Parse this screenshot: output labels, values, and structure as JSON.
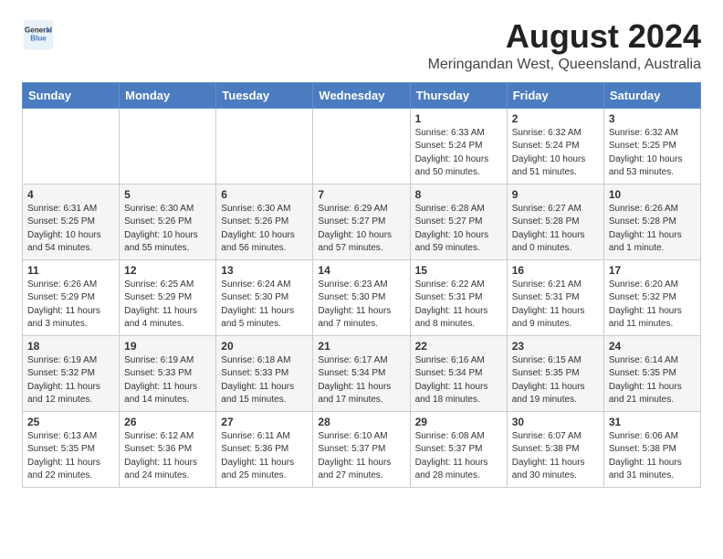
{
  "header": {
    "logo_line1": "General",
    "logo_line2": "Blue",
    "title": "August 2024",
    "subtitle": "Meringandan West, Queensland, Australia"
  },
  "weekdays": [
    "Sunday",
    "Monday",
    "Tuesday",
    "Wednesday",
    "Thursday",
    "Friday",
    "Saturday"
  ],
  "weeks": [
    [
      {
        "day": "",
        "sunrise": "",
        "sunset": "",
        "daylight": ""
      },
      {
        "day": "",
        "sunrise": "",
        "sunset": "",
        "daylight": ""
      },
      {
        "day": "",
        "sunrise": "",
        "sunset": "",
        "daylight": ""
      },
      {
        "day": "",
        "sunrise": "",
        "sunset": "",
        "daylight": ""
      },
      {
        "day": "1",
        "sunrise": "Sunrise: 6:33 AM",
        "sunset": "Sunset: 5:24 PM",
        "daylight": "Daylight: 10 hours and 50 minutes."
      },
      {
        "day": "2",
        "sunrise": "Sunrise: 6:32 AM",
        "sunset": "Sunset: 5:24 PM",
        "daylight": "Daylight: 10 hours and 51 minutes."
      },
      {
        "day": "3",
        "sunrise": "Sunrise: 6:32 AM",
        "sunset": "Sunset: 5:25 PM",
        "daylight": "Daylight: 10 hours and 53 minutes."
      }
    ],
    [
      {
        "day": "4",
        "sunrise": "Sunrise: 6:31 AM",
        "sunset": "Sunset: 5:25 PM",
        "daylight": "Daylight: 10 hours and 54 minutes."
      },
      {
        "day": "5",
        "sunrise": "Sunrise: 6:30 AM",
        "sunset": "Sunset: 5:26 PM",
        "daylight": "Daylight: 10 hours and 55 minutes."
      },
      {
        "day": "6",
        "sunrise": "Sunrise: 6:30 AM",
        "sunset": "Sunset: 5:26 PM",
        "daylight": "Daylight: 10 hours and 56 minutes."
      },
      {
        "day": "7",
        "sunrise": "Sunrise: 6:29 AM",
        "sunset": "Sunset: 5:27 PM",
        "daylight": "Daylight: 10 hours and 57 minutes."
      },
      {
        "day": "8",
        "sunrise": "Sunrise: 6:28 AM",
        "sunset": "Sunset: 5:27 PM",
        "daylight": "Daylight: 10 hours and 59 minutes."
      },
      {
        "day": "9",
        "sunrise": "Sunrise: 6:27 AM",
        "sunset": "Sunset: 5:28 PM",
        "daylight": "Daylight: 11 hours and 0 minutes."
      },
      {
        "day": "10",
        "sunrise": "Sunrise: 6:26 AM",
        "sunset": "Sunset: 5:28 PM",
        "daylight": "Daylight: 11 hours and 1 minute."
      }
    ],
    [
      {
        "day": "11",
        "sunrise": "Sunrise: 6:26 AM",
        "sunset": "Sunset: 5:29 PM",
        "daylight": "Daylight: 11 hours and 3 minutes."
      },
      {
        "day": "12",
        "sunrise": "Sunrise: 6:25 AM",
        "sunset": "Sunset: 5:29 PM",
        "daylight": "Daylight: 11 hours and 4 minutes."
      },
      {
        "day": "13",
        "sunrise": "Sunrise: 6:24 AM",
        "sunset": "Sunset: 5:30 PM",
        "daylight": "Daylight: 11 hours and 5 minutes."
      },
      {
        "day": "14",
        "sunrise": "Sunrise: 6:23 AM",
        "sunset": "Sunset: 5:30 PM",
        "daylight": "Daylight: 11 hours and 7 minutes."
      },
      {
        "day": "15",
        "sunrise": "Sunrise: 6:22 AM",
        "sunset": "Sunset: 5:31 PM",
        "daylight": "Daylight: 11 hours and 8 minutes."
      },
      {
        "day": "16",
        "sunrise": "Sunrise: 6:21 AM",
        "sunset": "Sunset: 5:31 PM",
        "daylight": "Daylight: 11 hours and 9 minutes."
      },
      {
        "day": "17",
        "sunrise": "Sunrise: 6:20 AM",
        "sunset": "Sunset: 5:32 PM",
        "daylight": "Daylight: 11 hours and 11 minutes."
      }
    ],
    [
      {
        "day": "18",
        "sunrise": "Sunrise: 6:19 AM",
        "sunset": "Sunset: 5:32 PM",
        "daylight": "Daylight: 11 hours and 12 minutes."
      },
      {
        "day": "19",
        "sunrise": "Sunrise: 6:19 AM",
        "sunset": "Sunset: 5:33 PM",
        "daylight": "Daylight: 11 hours and 14 minutes."
      },
      {
        "day": "20",
        "sunrise": "Sunrise: 6:18 AM",
        "sunset": "Sunset: 5:33 PM",
        "daylight": "Daylight: 11 hours and 15 minutes."
      },
      {
        "day": "21",
        "sunrise": "Sunrise: 6:17 AM",
        "sunset": "Sunset: 5:34 PM",
        "daylight": "Daylight: 11 hours and 17 minutes."
      },
      {
        "day": "22",
        "sunrise": "Sunrise: 6:16 AM",
        "sunset": "Sunset: 5:34 PM",
        "daylight": "Daylight: 11 hours and 18 minutes."
      },
      {
        "day": "23",
        "sunrise": "Sunrise: 6:15 AM",
        "sunset": "Sunset: 5:35 PM",
        "daylight": "Daylight: 11 hours and 19 minutes."
      },
      {
        "day": "24",
        "sunrise": "Sunrise: 6:14 AM",
        "sunset": "Sunset: 5:35 PM",
        "daylight": "Daylight: 11 hours and 21 minutes."
      }
    ],
    [
      {
        "day": "25",
        "sunrise": "Sunrise: 6:13 AM",
        "sunset": "Sunset: 5:35 PM",
        "daylight": "Daylight: 11 hours and 22 minutes."
      },
      {
        "day": "26",
        "sunrise": "Sunrise: 6:12 AM",
        "sunset": "Sunset: 5:36 PM",
        "daylight": "Daylight: 11 hours and 24 minutes."
      },
      {
        "day": "27",
        "sunrise": "Sunrise: 6:11 AM",
        "sunset": "Sunset: 5:36 PM",
        "daylight": "Daylight: 11 hours and 25 minutes."
      },
      {
        "day": "28",
        "sunrise": "Sunrise: 6:10 AM",
        "sunset": "Sunset: 5:37 PM",
        "daylight": "Daylight: 11 hours and 27 minutes."
      },
      {
        "day": "29",
        "sunrise": "Sunrise: 6:08 AM",
        "sunset": "Sunset: 5:37 PM",
        "daylight": "Daylight: 11 hours and 28 minutes."
      },
      {
        "day": "30",
        "sunrise": "Sunrise: 6:07 AM",
        "sunset": "Sunset: 5:38 PM",
        "daylight": "Daylight: 11 hours and 30 minutes."
      },
      {
        "day": "31",
        "sunrise": "Sunrise: 6:06 AM",
        "sunset": "Sunset: 5:38 PM",
        "daylight": "Daylight: 11 hours and 31 minutes."
      }
    ]
  ]
}
